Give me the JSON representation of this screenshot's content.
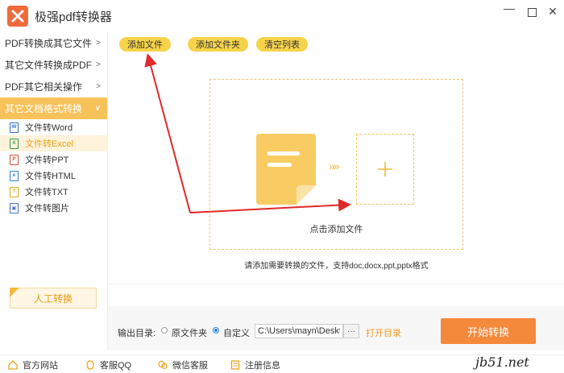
{
  "window": {
    "title": "极强pdf转换器",
    "minimize_icon": "minimize-icon",
    "maximize_icon": "maximize-icon",
    "close_icon": "close-icon"
  },
  "sidebar": {
    "categories": [
      {
        "label": "PDF转换成其它文件",
        "chevron": ">"
      },
      {
        "label": "其它文件转换成PDF",
        "chevron": ">"
      },
      {
        "label": "PDF其它相关操作",
        "chevron": ">"
      },
      {
        "label": "其它文档格式转换",
        "chevron": "∨",
        "active": true
      }
    ],
    "sub_items": [
      {
        "label": "文件转Word",
        "icon": "word-file-icon"
      },
      {
        "label": "文件转Excel",
        "icon": "excel-file-icon",
        "active": true
      },
      {
        "label": "文件转PPT",
        "icon": "ppt-file-icon"
      },
      {
        "label": "文件转HTML",
        "icon": "html-file-icon"
      },
      {
        "label": "文件转TXT",
        "icon": "txt-file-icon"
      },
      {
        "label": "文件转图片",
        "icon": "image-file-icon"
      }
    ],
    "manual_button": "人工转换"
  },
  "toolbar": {
    "add_file": "添加文件",
    "add_folder": "添加文件夹",
    "clear_list": "清空列表"
  },
  "dropzone": {
    "label": "点击添加文件",
    "arrows": "»»",
    "hint": "请添加需要转换的文件，支持doc,docx,ppt,pptx格式"
  },
  "output": {
    "label": "输出目录:",
    "option_original": "原文件夹",
    "option_custom": "自定义",
    "selected": "custom",
    "path": "C:\\Users\\mayn\\Deskt",
    "browse": "···",
    "open_dir": "打开目录",
    "start": "开始转换"
  },
  "footer": {
    "items": [
      {
        "label": "官方网站",
        "icon": "home-icon"
      },
      {
        "label": "客服QQ",
        "icon": "qq-icon"
      },
      {
        "label": "微信客服",
        "icon": "wechat-icon"
      },
      {
        "label": "注册信息",
        "icon": "register-icon"
      }
    ],
    "watermark": "jb51.net"
  },
  "colors": {
    "accent": "#f7c25a",
    "start": "#f5893b",
    "annotation_arrow": "#e02a2a",
    "dashed": "#f0c46a"
  }
}
